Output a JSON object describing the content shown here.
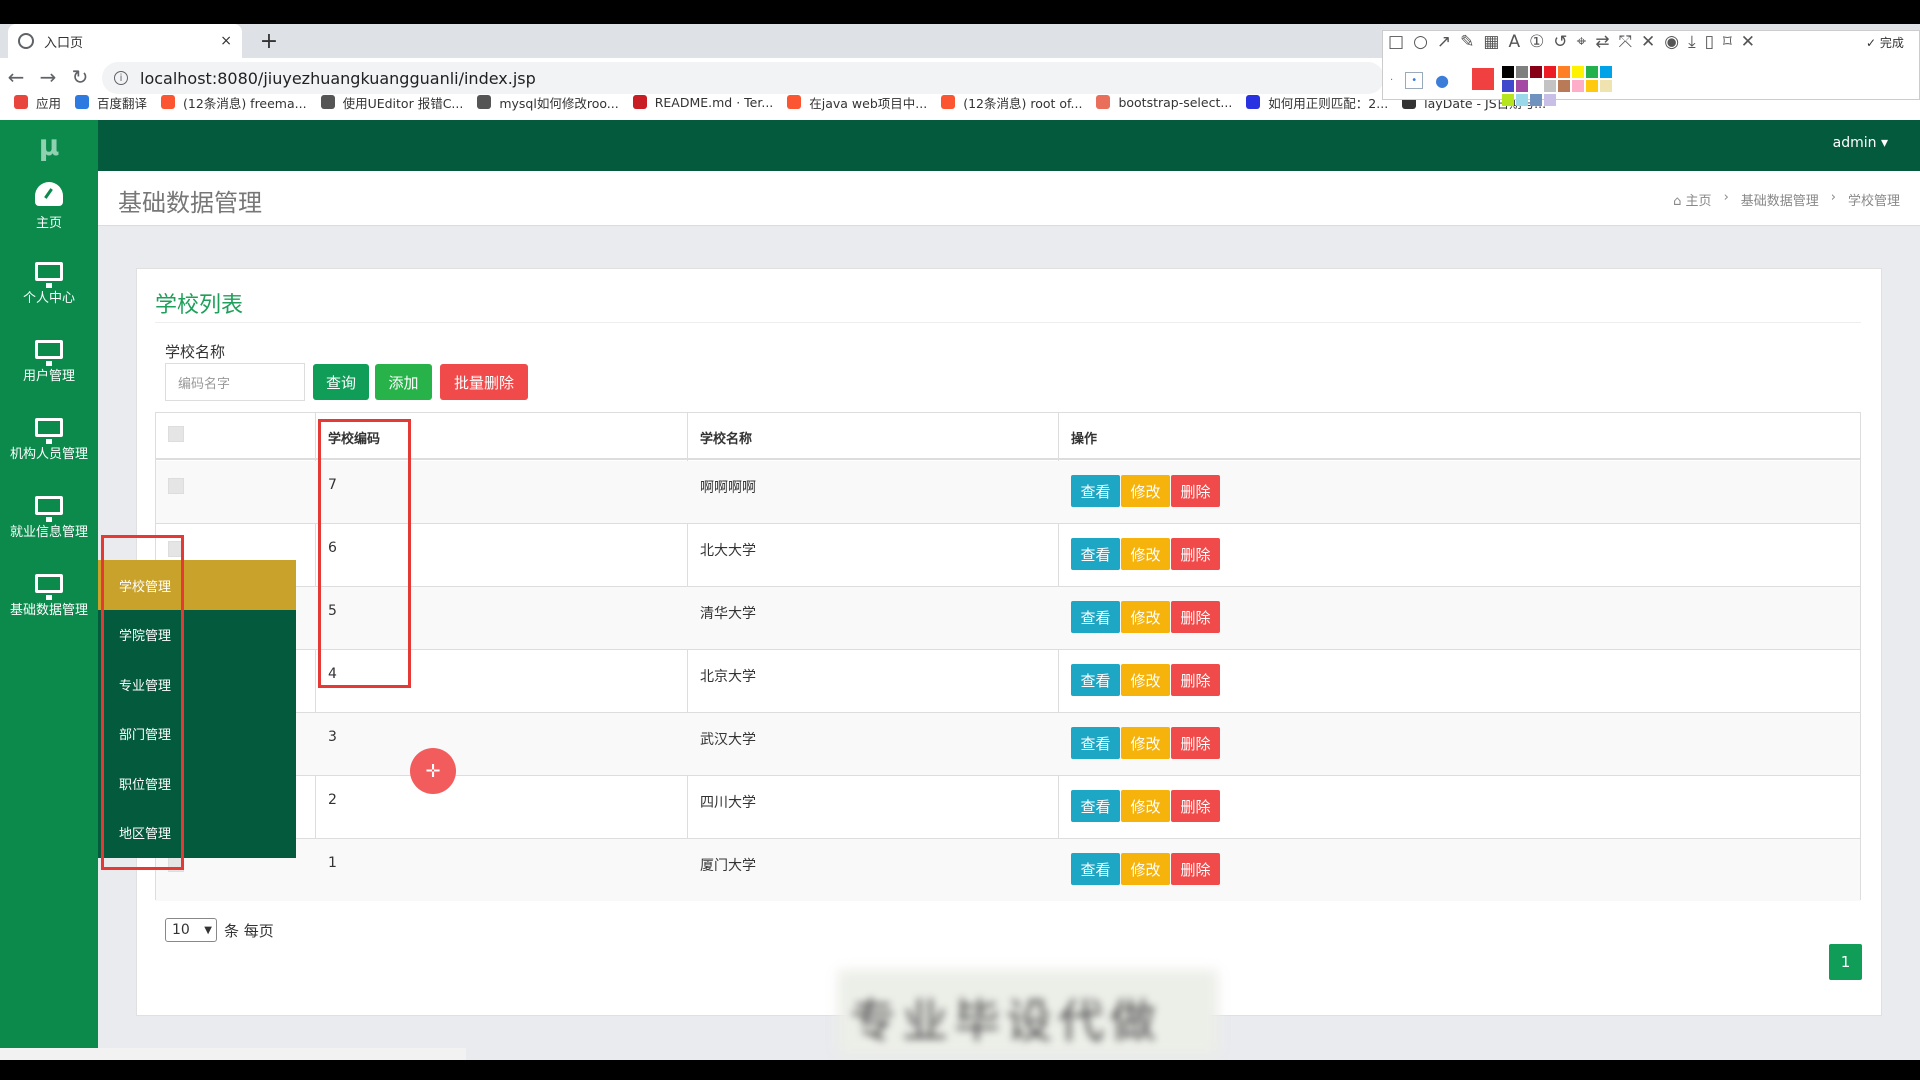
{
  "browser": {
    "tab_title": "入口页",
    "tab_close": "×",
    "new_tab": "+",
    "url": "localhost:8080/jiuyezhuangkuangguanli/index.jsp",
    "bookmarks": [
      {
        "label": "应用",
        "icon": "apps-icon"
      },
      {
        "label": "百度翻译",
        "icon": "baidu-translate-icon"
      },
      {
        "label": "(12条消息) freema...",
        "icon": "csdn-icon"
      },
      {
        "label": "使用UEditor 报错C...",
        "icon": "link-icon"
      },
      {
        "label": "mysql如何修改roo...",
        "icon": "link-icon"
      },
      {
        "label": "README.md · Ter...",
        "icon": "gitee-icon"
      },
      {
        "label": "在java web项目中...",
        "icon": "csdn-icon"
      },
      {
        "label": "(12条消息) root of...",
        "icon": "csdn-icon"
      },
      {
        "label": "bootstrap-select...",
        "icon": "jianshu-icon"
      },
      {
        "label": "如何用正则匹配：2...",
        "icon": "baidu-icon"
      },
      {
        "label": "layDate - JS日期与...",
        "icon": "laydate-icon"
      }
    ]
  },
  "annotation_toolbar": {
    "done_label": "完成",
    "colors": [
      "#000000",
      "#7f7f7f",
      "#880015",
      "#ed1c24",
      "#ff7f27",
      "#fff200",
      "#22b14c",
      "#00a2e8",
      "#3f48cc",
      "#a349a4",
      "#ffffff",
      "#c3c3c3",
      "#b97a57",
      "#ffaec9",
      "#ffc90e",
      "#efe4b0",
      "#b5e61d",
      "#99d9ea",
      "#7092be",
      "#c8bfe7"
    ],
    "current_color": "#f04040"
  },
  "app": {
    "logo": "μ",
    "user": "admin ▾",
    "sidebar": [
      {
        "label": "主页",
        "icon": "dashboard-icon"
      },
      {
        "label": "个人中心",
        "icon": "monitor-icon"
      },
      {
        "label": "用户管理",
        "icon": "monitor-icon"
      },
      {
        "label": "机构人员管理",
        "icon": "monitor-icon"
      },
      {
        "label": "就业信息管理",
        "icon": "monitor-icon"
      },
      {
        "label": "基础数据管理",
        "icon": "monitor-icon"
      }
    ],
    "submenu": [
      "学校管理",
      "学院管理",
      "专业管理",
      "部门管理",
      "职位管理",
      "地区管理"
    ],
    "page_title": "基础数据管理",
    "breadcrumb": [
      "主页",
      "基础数据管理",
      "学校管理"
    ],
    "breadcrumb_sep": "›"
  },
  "panel": {
    "title": "学校列表",
    "search_label": "学校名称",
    "search_placeholder": "编码名字",
    "query_btn": "查询",
    "add_btn": "添加",
    "batch_delete_btn": "批量删除"
  },
  "table": {
    "columns": [
      "学校编码",
      "学校名称",
      "操作"
    ],
    "rows": [
      {
        "code": "7",
        "name": "啊啊啊啊"
      },
      {
        "code": "6",
        "name": "北大大学"
      },
      {
        "code": "5",
        "name": "清华大学"
      },
      {
        "code": "4",
        "name": "北京大学"
      },
      {
        "code": "3",
        "name": "武汉大学"
      },
      {
        "code": "2",
        "name": "四川大学"
      },
      {
        "code": "1",
        "name": "厦门大学"
      }
    ],
    "actions": {
      "view": "查看",
      "edit": "修改",
      "delete": "删除"
    }
  },
  "pagination": {
    "page_size": "10",
    "page_size_label": "条 每页",
    "current_page": "1"
  },
  "watermark": "专业毕设代做"
}
